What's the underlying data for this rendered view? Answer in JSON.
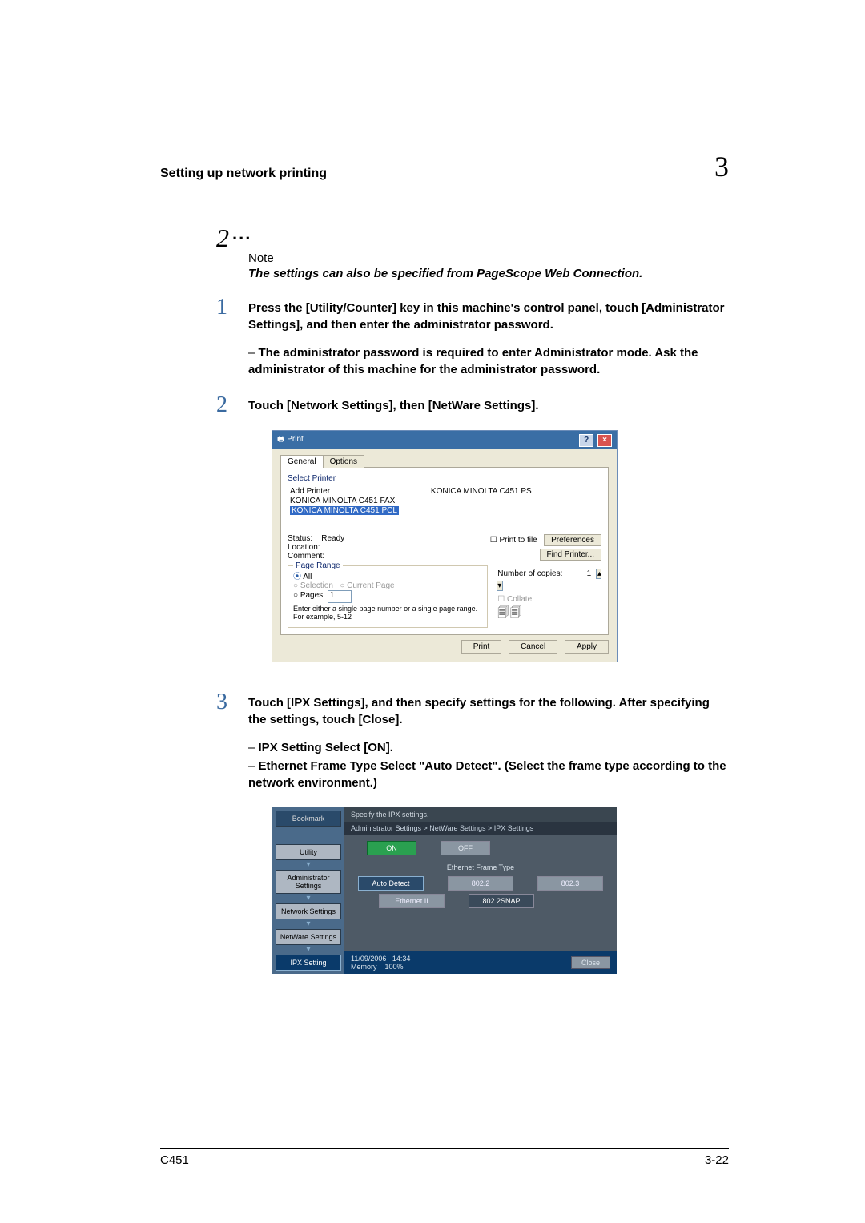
{
  "header": {
    "section": "Setting up network printing",
    "chapter": "3"
  },
  "note": {
    "num": "2",
    "label": "Note",
    "text": "The settings can also be specified from PageScope Web Connection."
  },
  "steps": {
    "s1": {
      "num": "1",
      "text": "Press the [Utility/Counter] key in this machine's control panel, touch [Administrator Settings], and then enter the administrator password.",
      "sub": "The administrator password is required to enter Administrator mode. Ask the administrator of this machine for the administrator password."
    },
    "s2": {
      "num": "2",
      "text": "Touch [Network Settings], then [NetWare Settings]."
    },
    "s3": {
      "num": "3",
      "text": "Touch [IPX Settings], and then specify settings for the following. After specifying the settings, touch [Close].",
      "sub1": "IPX Setting Select [ON].",
      "sub2": "Ethernet Frame Type Select \"Auto Detect\". (Select the frame type according to the network environment.)"
    }
  },
  "print_dialog": {
    "title": "Print",
    "tab_general": "General",
    "tab_options": "Options",
    "select_printer": "Select Printer",
    "printers": {
      "add": "Add Printer",
      "fax": "KONICA MINOLTA C451 FAX",
      "pcl": "KONICA MINOLTA C451 PCL",
      "ps": "KONICA MINOLTA C451 PS"
    },
    "status_lbl": "Status:",
    "status_val": "Ready",
    "location_lbl": "Location:",
    "comment_lbl": "Comment:",
    "print_to_file": "Print to file",
    "preferences": "Preferences",
    "find_printer": "Find Printer...",
    "page_range": "Page Range",
    "all": "All",
    "selection": "Selection",
    "current_page": "Current Page",
    "pages": "Pages:",
    "pages_val": "1",
    "pages_hint": "Enter either a single page number or a single page range.  For example, 5-12",
    "copies_lbl": "Number of copies:",
    "copies_val": "1",
    "collate": "Collate",
    "btn_print": "Print",
    "btn_cancel": "Cancel",
    "btn_apply": "Apply"
  },
  "touch_panel": {
    "side": {
      "bookmark": "Bookmark",
      "utility": "Utility",
      "admin": "Administrator Settings",
      "network": "Network Settings",
      "netware": "NetWare Settings",
      "ipx": "IPX Setting"
    },
    "top": "Specify the IPX settings.",
    "crumb": "Administrator Settings > NetWare Settings > IPX Settings",
    "on": "ON",
    "off": "OFF",
    "frame_label": "Ethernet Frame Type",
    "opts": {
      "auto": "Auto Detect",
      "o8022": "802.2",
      "o8023": "802.3",
      "eth2": "Ethernet II",
      "snap": "802.2SNAP"
    },
    "dt_date": "11/09/2006",
    "dt_time": "14:34",
    "mem_lbl": "Memory",
    "mem_val": "100%",
    "close": "Close"
  },
  "footer": {
    "model": "C451",
    "page": "3-22"
  }
}
